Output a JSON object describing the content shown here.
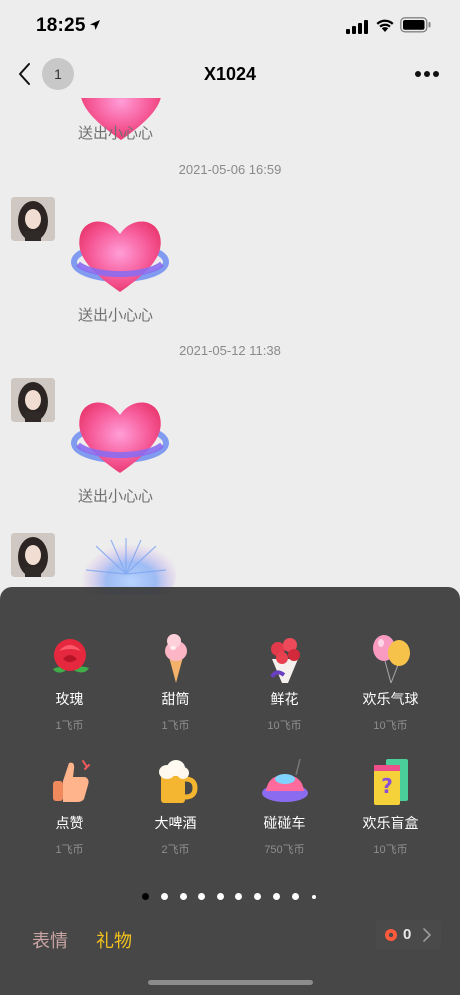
{
  "status_bar": {
    "time": "18:25"
  },
  "nav": {
    "unread_count": "1",
    "title": "X1024"
  },
  "messages": [
    {
      "caption": "送出小心心"
    },
    {
      "timestamp": "2021-05-06 16:59",
      "caption": "送出小心心"
    },
    {
      "timestamp": "2021-05-12 11:38",
      "caption": "送出小心心"
    }
  ],
  "gifts": [
    {
      "icon": "rose-icon",
      "name": "玫瑰",
      "price": "1飞币"
    },
    {
      "icon": "ice-cream-icon",
      "name": "甜筒",
      "price": "1飞币"
    },
    {
      "icon": "bouquet-icon",
      "name": "鲜花",
      "price": "10飞币"
    },
    {
      "icon": "balloons-icon",
      "name": "欢乐气球",
      "price": "10飞币"
    },
    {
      "icon": "thumbs-up-icon",
      "name": "点赞",
      "price": "1飞币"
    },
    {
      "icon": "beer-icon",
      "name": "大啤酒",
      "price": "2飞币"
    },
    {
      "icon": "bumper-car-icon",
      "name": "碰碰车",
      "price": "750飞币"
    },
    {
      "icon": "mystery-box-icon",
      "name": "欢乐盲盒",
      "price": "10飞币"
    }
  ],
  "pagination": {
    "total_pages": 10,
    "current_page": 1
  },
  "tabs": {
    "emoji": "表情",
    "gift": "礼物"
  },
  "coins": {
    "balance": "0"
  },
  "colors": {
    "accent_yellow": "#f4c21b",
    "panel_bg": "#3a3a3a",
    "heart_pink": "#f2487a"
  }
}
